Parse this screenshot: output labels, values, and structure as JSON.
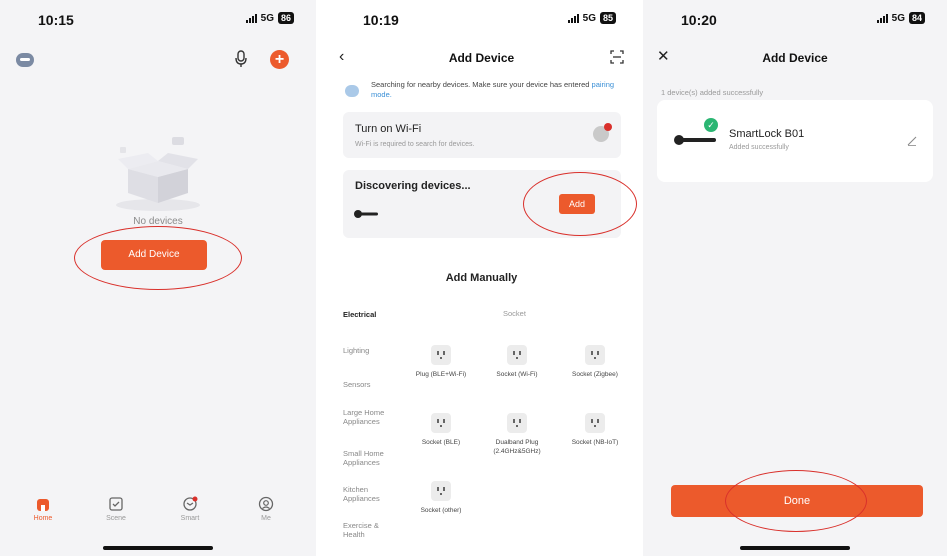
{
  "panels": [
    {
      "status": {
        "time": "10:15",
        "network": "5G",
        "battery": "86"
      },
      "empty_label": "No devices",
      "add_button": "Add Device",
      "tabs": [
        {
          "label": "Home",
          "icon": "home-icon"
        },
        {
          "label": "Scene",
          "icon": "scene-icon"
        },
        {
          "label": "Smart",
          "icon": "smart-icon"
        },
        {
          "label": "Me",
          "icon": "profile-icon"
        }
      ]
    },
    {
      "status": {
        "time": "10:19",
        "network": "5G",
        "battery": "85"
      },
      "title": "Add Device",
      "searching_text": "Searching for nearby devices. Make sure your device has entered",
      "pairing_link": "pairing mode.",
      "wifi_title": "Turn on Wi-Fi",
      "wifi_sub": "Wi-Fi is required to search for devices.",
      "discovering_title": "Discovering devices...",
      "add_label": "Add",
      "manual_title": "Add Manually",
      "categories": [
        "Electrical",
        "Lighting",
        "Sensors",
        "Large Home Appliances",
        "Small Home Appliances",
        "Kitchen Appliances",
        "Exercise & Health"
      ],
      "socket_header": "Socket",
      "products": [
        "Plug (BLE+Wi-Fi)",
        "Socket (Wi-Fi)",
        "Socket (Zigbee)",
        "Socket (BLE)",
        "Dualband Plug (2.4GHz&5GHz)",
        "Socket (NB-IoT)",
        "Socket (other)"
      ]
    },
    {
      "status": {
        "time": "10:20",
        "network": "5G",
        "battery": "84"
      },
      "title": "Add Device",
      "added_text": "1 device(s) added successfully",
      "device_name": "SmartLock B01",
      "device_status": "Added successfully",
      "done_label": "Done"
    }
  ],
  "colors": {
    "accent": "#ec5a2c",
    "annotation": "#d9302b",
    "success": "#2bb673",
    "link": "#3a8fd6"
  }
}
